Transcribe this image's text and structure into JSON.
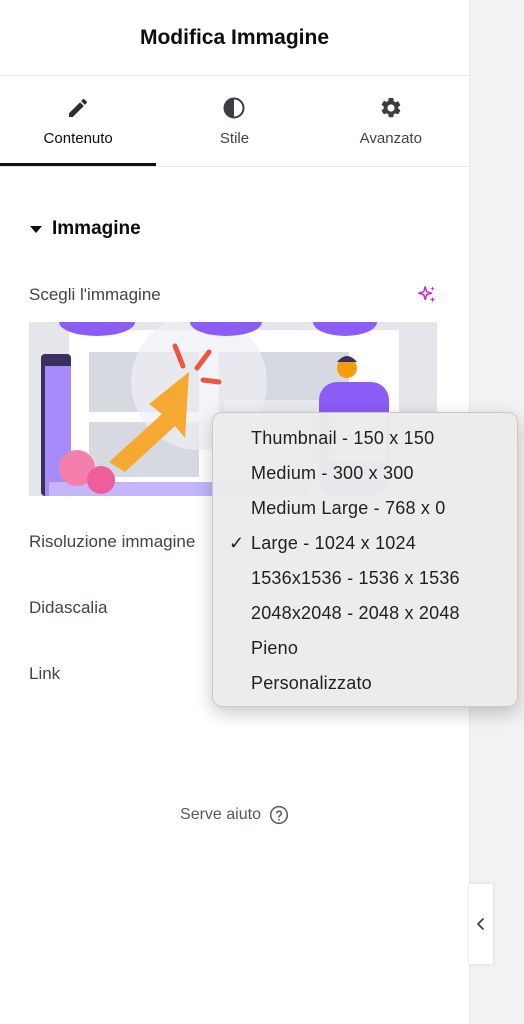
{
  "header": {
    "title": "Modifica Immagine"
  },
  "tabs": [
    {
      "label": "Contenuto",
      "icon": "pencil-icon",
      "active": true
    },
    {
      "label": "Stile",
      "icon": "contrast-icon",
      "active": false
    },
    {
      "label": "Avanzato",
      "icon": "gear-icon",
      "active": false
    }
  ],
  "section": {
    "title": "Immagine"
  },
  "fields": {
    "choose_image": "Scegli l'immagine",
    "resolution": "Risoluzione immagine",
    "caption": "Didascalia",
    "link": "Link"
  },
  "help": {
    "label": "Serve aiuto"
  },
  "resolution_dropdown": {
    "selected": "Large - 1024 x 1024",
    "options": [
      "Thumbnail - 150 x 150",
      "Medium - 300 x 300",
      "Medium Large - 768 x 0",
      "Large - 1024 x 1024",
      "1536x1536 - 1536 x 1536",
      "2048x2048 - 2048 x 2048",
      "Pieno",
      "Personalizzato"
    ]
  },
  "colors": {
    "accent_ai": "#c026d3",
    "active_tab_underline": "#0c0d0e",
    "illustration_purple": "#8b5cf6",
    "illustration_orange": "#f59e0b"
  }
}
